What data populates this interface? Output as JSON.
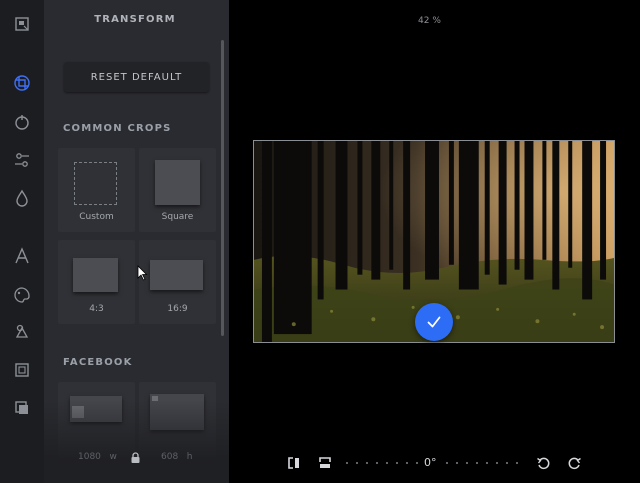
{
  "panel": {
    "title": "TRANSFORM",
    "reset_label": "RESET DEFAULT",
    "sections": {
      "common_crops": "COMMON CROPS",
      "facebook": "FACEBOOK"
    },
    "crops": [
      {
        "label": "Custom"
      },
      {
        "label": "Square"
      },
      {
        "label": "4:3"
      },
      {
        "label": "16:9"
      }
    ],
    "dimensions": {
      "width": "1080",
      "width_unit": "w",
      "height": "608",
      "height_unit": "h"
    }
  },
  "rail": {
    "icons": [
      "frame-icon",
      "transform-icon",
      "filter-icon",
      "adjust-icon",
      "focus-icon",
      "text-icon",
      "paint-icon",
      "sticker-icon",
      "border-icon",
      "overlay-icon"
    ],
    "active": "transform-icon"
  },
  "canvas": {
    "zoom": "42 %"
  },
  "toolbar": {
    "angle": "0°"
  },
  "colors": {
    "accent": "#2d6df6",
    "panel_bg": "#2a2b30",
    "rail_bg": "#1c1d21",
    "canvas_bg": "#000000"
  }
}
